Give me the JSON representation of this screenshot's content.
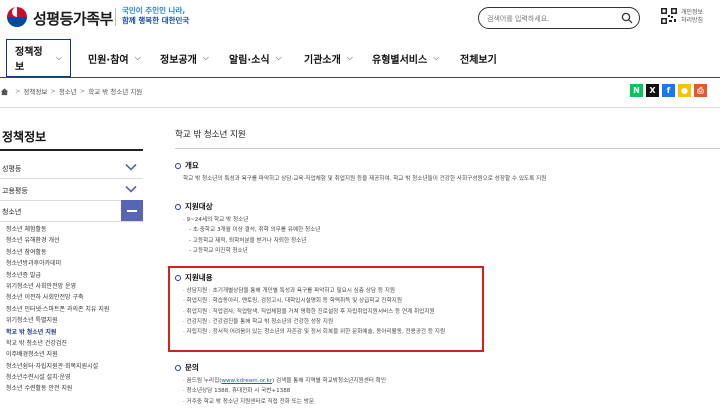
{
  "header": {
    "site_name": "성평등가족부",
    "slogan_line1": "국민이 주인인 나라,",
    "slogan_line2": "함께 행복한 대한민국",
    "search_placeholder": "검색어를 입력하세요.",
    "qr_line1": "개인정보",
    "qr_line2": "처리방침",
    "colors": {
      "slogan_light": "#1e86d6",
      "slogan_dark": "#1a4da1",
      "nav_active": "#0b3a8a"
    }
  },
  "nav": {
    "items": [
      {
        "label": "정책정보",
        "chevron": "⌵"
      },
      {
        "label": "민원·참여",
        "chevron": "⌵"
      },
      {
        "label": "정보공개",
        "chevron": "⌵"
      },
      {
        "label": "알림·소식",
        "chevron": "⌵"
      },
      {
        "label": "기관소개",
        "chevron": "⌵"
      },
      {
        "label": "유형별서비스",
        "chevron": "⌵"
      },
      {
        "label": "전체보기",
        "chevron": ""
      }
    ]
  },
  "breadcrumb": {
    "items": [
      "정책정보",
      "청소년",
      "학교 밖 청소년 지원"
    ],
    "separator": ">"
  },
  "share": {
    "buttons": [
      {
        "label": "N",
        "color": "#03c75a",
        "icon": "naver-blog-icon"
      },
      {
        "label": "X",
        "color": "#111111",
        "icon": "x-icon"
      },
      {
        "label": "f",
        "color": "#1877f2",
        "icon": "facebook-icon"
      },
      {
        "label": "●",
        "color": "#f7c300",
        "icon": "kakaostory-icon"
      },
      {
        "label": "⎙",
        "color": "#e8572a",
        "icon": "print-icon"
      }
    ]
  },
  "sidebar": {
    "title": "정책정보",
    "items": [
      {
        "label": "성평등"
      },
      {
        "label": "고용평등"
      },
      {
        "label": "청소년"
      }
    ],
    "sub_items": [
      "청소년 체험활동",
      "청소년 유해환경 개선",
      "청소년 참여활동",
      "청소년방과후아카데미",
      "청소년증 발급",
      "위기청소년 사회안전망 운영",
      "청소년 이전하 사회안전망 구축",
      "청소년 인터넷·스마트폰 과의존 치유 지원",
      "위기청소년 특별지원",
      "학교 밖 청소년 지원",
      "학교 밖 청소년 건강검진",
      "이주배경청소년 지원",
      "청소년쉼터·자립지원관·회복지원시설",
      "청소년수련시설 설치·운영",
      "청소년 수련활동 안전 지원"
    ],
    "current_index": 9,
    "colors": {
      "expanded": "#5865b5",
      "chevron": "#5865b5"
    }
  },
  "content": {
    "title": "학교 밖 청소년 지원",
    "sections": [
      {
        "heading": "개요",
        "lines": [
          "학교 밖 청소년의 특성과 욕구를 파악하고 상담·교육·직업체험 및 취업지원 등을 제공하여, 학교 밖 청소년들이 건강한 사회구성원으로 성장할 수 있도록 지원"
        ]
      },
      {
        "heading": "지원대상",
        "lines": [
          "· 9~24세의 학교 밖 청소년",
          "- 초·중학교 3개월 이상 결석, 취학 의무를 유예한 청소년",
          "- 고등학교 제적, 퇴학처분을 받거나 자퇴한 청소년",
          "- 고등학교 미진학 청소년"
        ]
      },
      {
        "heading": "지원내용",
        "lines": [
          "· 상담지원 : 초기개별상담을 통해 개인별 특성과 욕구를 파악하고 필요시 심층 상담 등 지원",
          "· 학업지원 : 학습동아리, 멘토링, 검정고시, 대학입시설명회 등 학력취득 및 상급학교 진학지원",
          "· 취업지원 : 직업검사, 직업탐색, 직업체험을 거쳐 명확한 진로설정 후 자립취업지원서비스 등 연계 취업지원",
          "· 건강지원 : 건강검진을 통해 학교 밖 청소년의 건강한 성장 지원",
          "· 자립지원 : 정서적 어려움이 있는 청소년의 자존감 및 정서 회복을 위한 문화예술, 동아리활동, 전용공간 등 지원"
        ]
      },
      {
        "heading": "문의",
        "lines": [
          "· 꿈드림 누리집",
          "· 청소년상담 1388, 휴대전화 시 국번+1388",
          "· 거주중 학교 밖 청소년 지원센터로 직접 전화 또는 방문"
        ],
        "link_text": "www.kdream.or.kr",
        "link_suffix": " 검색을 통해 지역별 학교밖청소년지원센터 확인"
      }
    ],
    "highlight_color": "#d42020"
  }
}
